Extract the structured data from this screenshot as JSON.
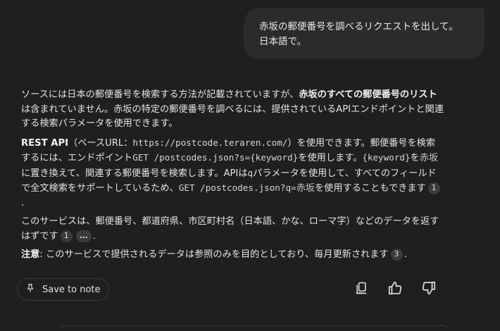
{
  "user_message": {
    "line1": "赤坂の郵便番号を調べるリクエストを出して。",
    "line2": "日本語で。"
  },
  "answer": {
    "p1": {
      "t1": "ソースには日本の郵便番号を検索する方法が記載されていますが、",
      "b1": "赤坂のすべての郵便番号のリスト",
      "t2": "は含まれていません。赤坂の特定の郵便番号を調べるには、提供されているAPIエンドポイントと関連する検索パラメータを使用できます。"
    },
    "p2": {
      "b1": "REST API",
      "t1": "（ベースURL：",
      "c1": "https://postcode.teraren.com/",
      "t2": "）を使用できます。郵便番号を検索するには、エンドポイント",
      "c2": "GET /postcodes.json?s={keyword}",
      "t3": "を使用します。",
      "c3": "{keyword}",
      "t4": "を",
      "h1": "赤坂",
      "t5": "に置き換えて、関連する郵便番号を検索します。APIは",
      "c4": "q",
      "t6": "パラメータを使用して、すべてのフィールドで全文検索をサポートしているため、",
      "c5": "GET /postcodes.json?q=",
      "h2": "赤坂",
      "t7": "を使用することもできます",
      "cite1": "1",
      "t8": "."
    },
    "p3": {
      "t1": "このサービスは、郵便番号、都道府県、市区町村名（日本語、かな、ローマ字）などのデータを返すはずです",
      "cite1": "1",
      "cite2": "...",
      "t2": "."
    },
    "p4": {
      "b1": "注意",
      "t1": ": このサービスで提供されるデータは参照のみを目的としており、毎月更新されます",
      "cite1": "3",
      "t2": "."
    }
  },
  "toolbar": {
    "save_label": "Save to note",
    "icons": [
      "pin-icon",
      "copy-icon",
      "thumbs-up-icon",
      "thumbs-down-icon"
    ]
  },
  "colors": {
    "background": "#1f1f1f",
    "bubble": "#2b2b2b",
    "text": "#e3e3e3",
    "chip": "#3c3c3c"
  }
}
